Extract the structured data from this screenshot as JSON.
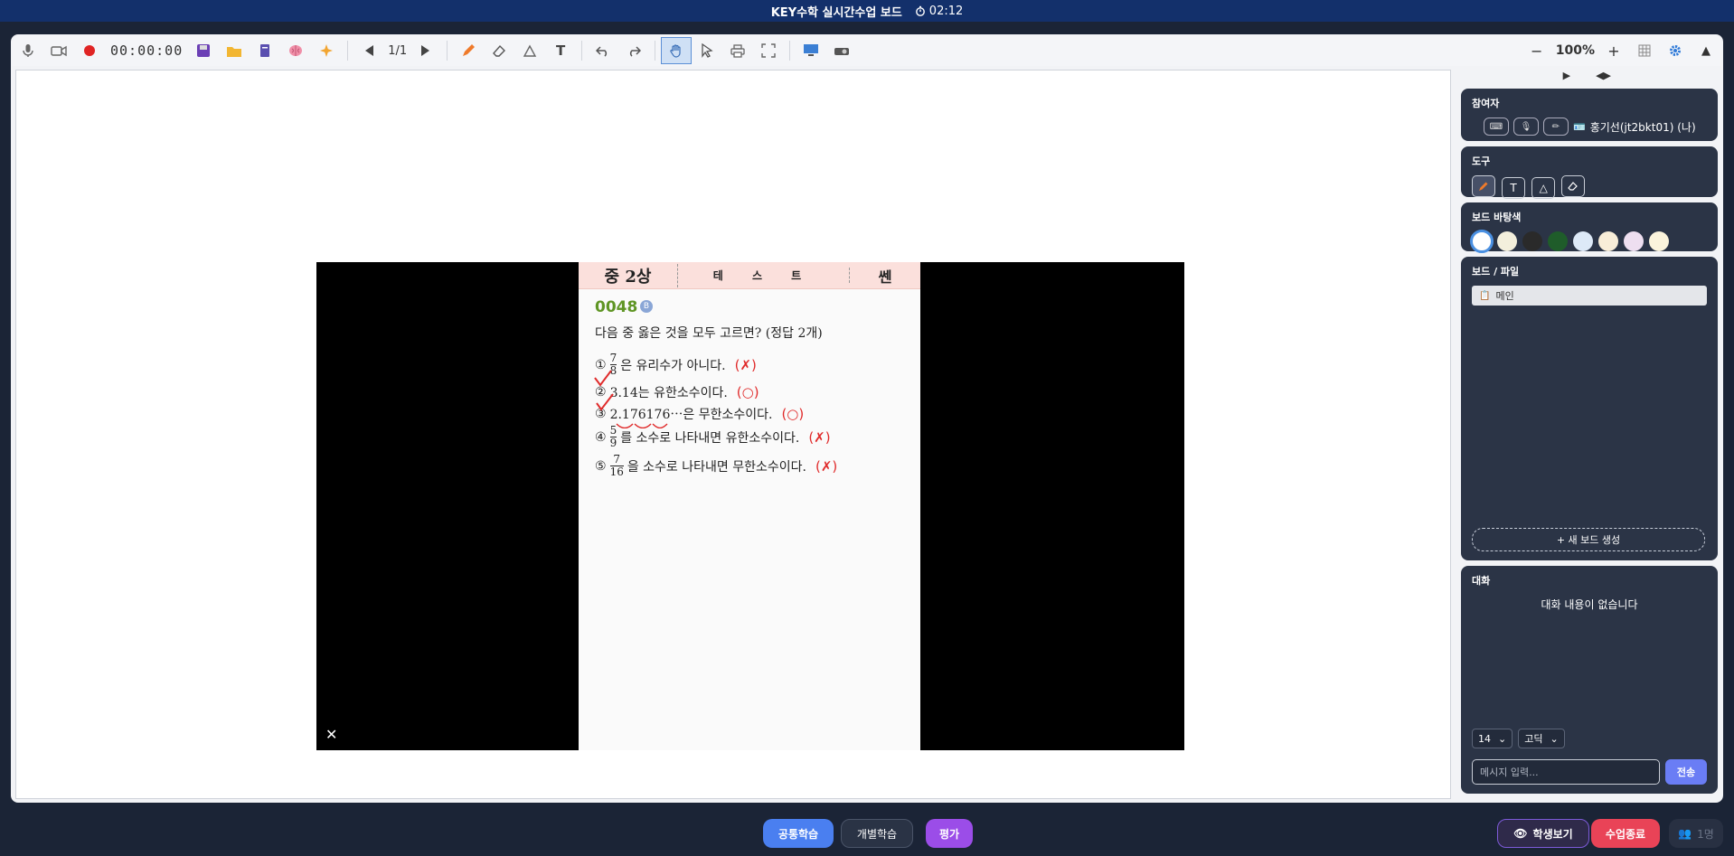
{
  "title": {
    "app": "KEY수학 실시간수업 보드",
    "timer_icon": "stopwatch-icon",
    "timer": "02:12"
  },
  "toolbar": {
    "record_time": "00:00:00",
    "page": "1/1",
    "zoom": "100%",
    "zoom_out": "−",
    "zoom_in": "+",
    "collapse": "▲"
  },
  "document": {
    "grade": "중 2상",
    "test": "테 스 트",
    "brand": "쎈",
    "qnum": "0048",
    "badge": "B",
    "question": "다음 중 옳은 것을 모두 고르면? (정답 2개)",
    "options": [
      {
        "n": "①",
        "num": "7",
        "den": "8",
        "text": "은 유리수가 아니다.",
        "mark": "(✗)"
      },
      {
        "n": "②",
        "text": "3.14는 유한소수이다.",
        "mark": "(○)"
      },
      {
        "n": "③",
        "text": "2.176176⋯은 무한소수이다.",
        "mark": "(○)"
      },
      {
        "n": "④",
        "num": "5",
        "den": "9",
        "text": "를 소수로 나타내면 유한소수이다.",
        "mark": "(✗)"
      },
      {
        "n": "⑤",
        "num": "7",
        "den": "16",
        "text": "을 소수로 나타내면 무한소수이다.",
        "mark": "(✗)"
      }
    ],
    "close": "✕"
  },
  "panel": {
    "participants_title": "참여자",
    "participant_name": "홍기선(jt2bkt01) (나)",
    "tools_title": "도구",
    "bg_title": "보드 바탕색",
    "bg_colors": [
      "#ffffff",
      "#f3efdc",
      "#2a2a2a",
      "#1f5c2a",
      "#dde9f7",
      "#f8edd8",
      "#eedff0",
      "#fbf4dc"
    ],
    "files_title": "보드 / 파일",
    "file_main": "메인",
    "new_board": "+ 새 보드 생성",
    "chat_title": "대화",
    "chat_empty": "대화 내용이 없습니다",
    "font_size": "14",
    "font_face": "고딕",
    "chat_placeholder": "메시지 입력...",
    "send": "전송"
  },
  "bottom": {
    "common": "공통학습",
    "individual": "개별학습",
    "eval": "평가",
    "students": "학생보기",
    "end": "수업종료",
    "count": "1명"
  },
  "colors": {
    "accent": "#4a7ff0",
    "danger": "#e94357",
    "purple": "#9b4de8",
    "titlebar": "#13306b"
  }
}
